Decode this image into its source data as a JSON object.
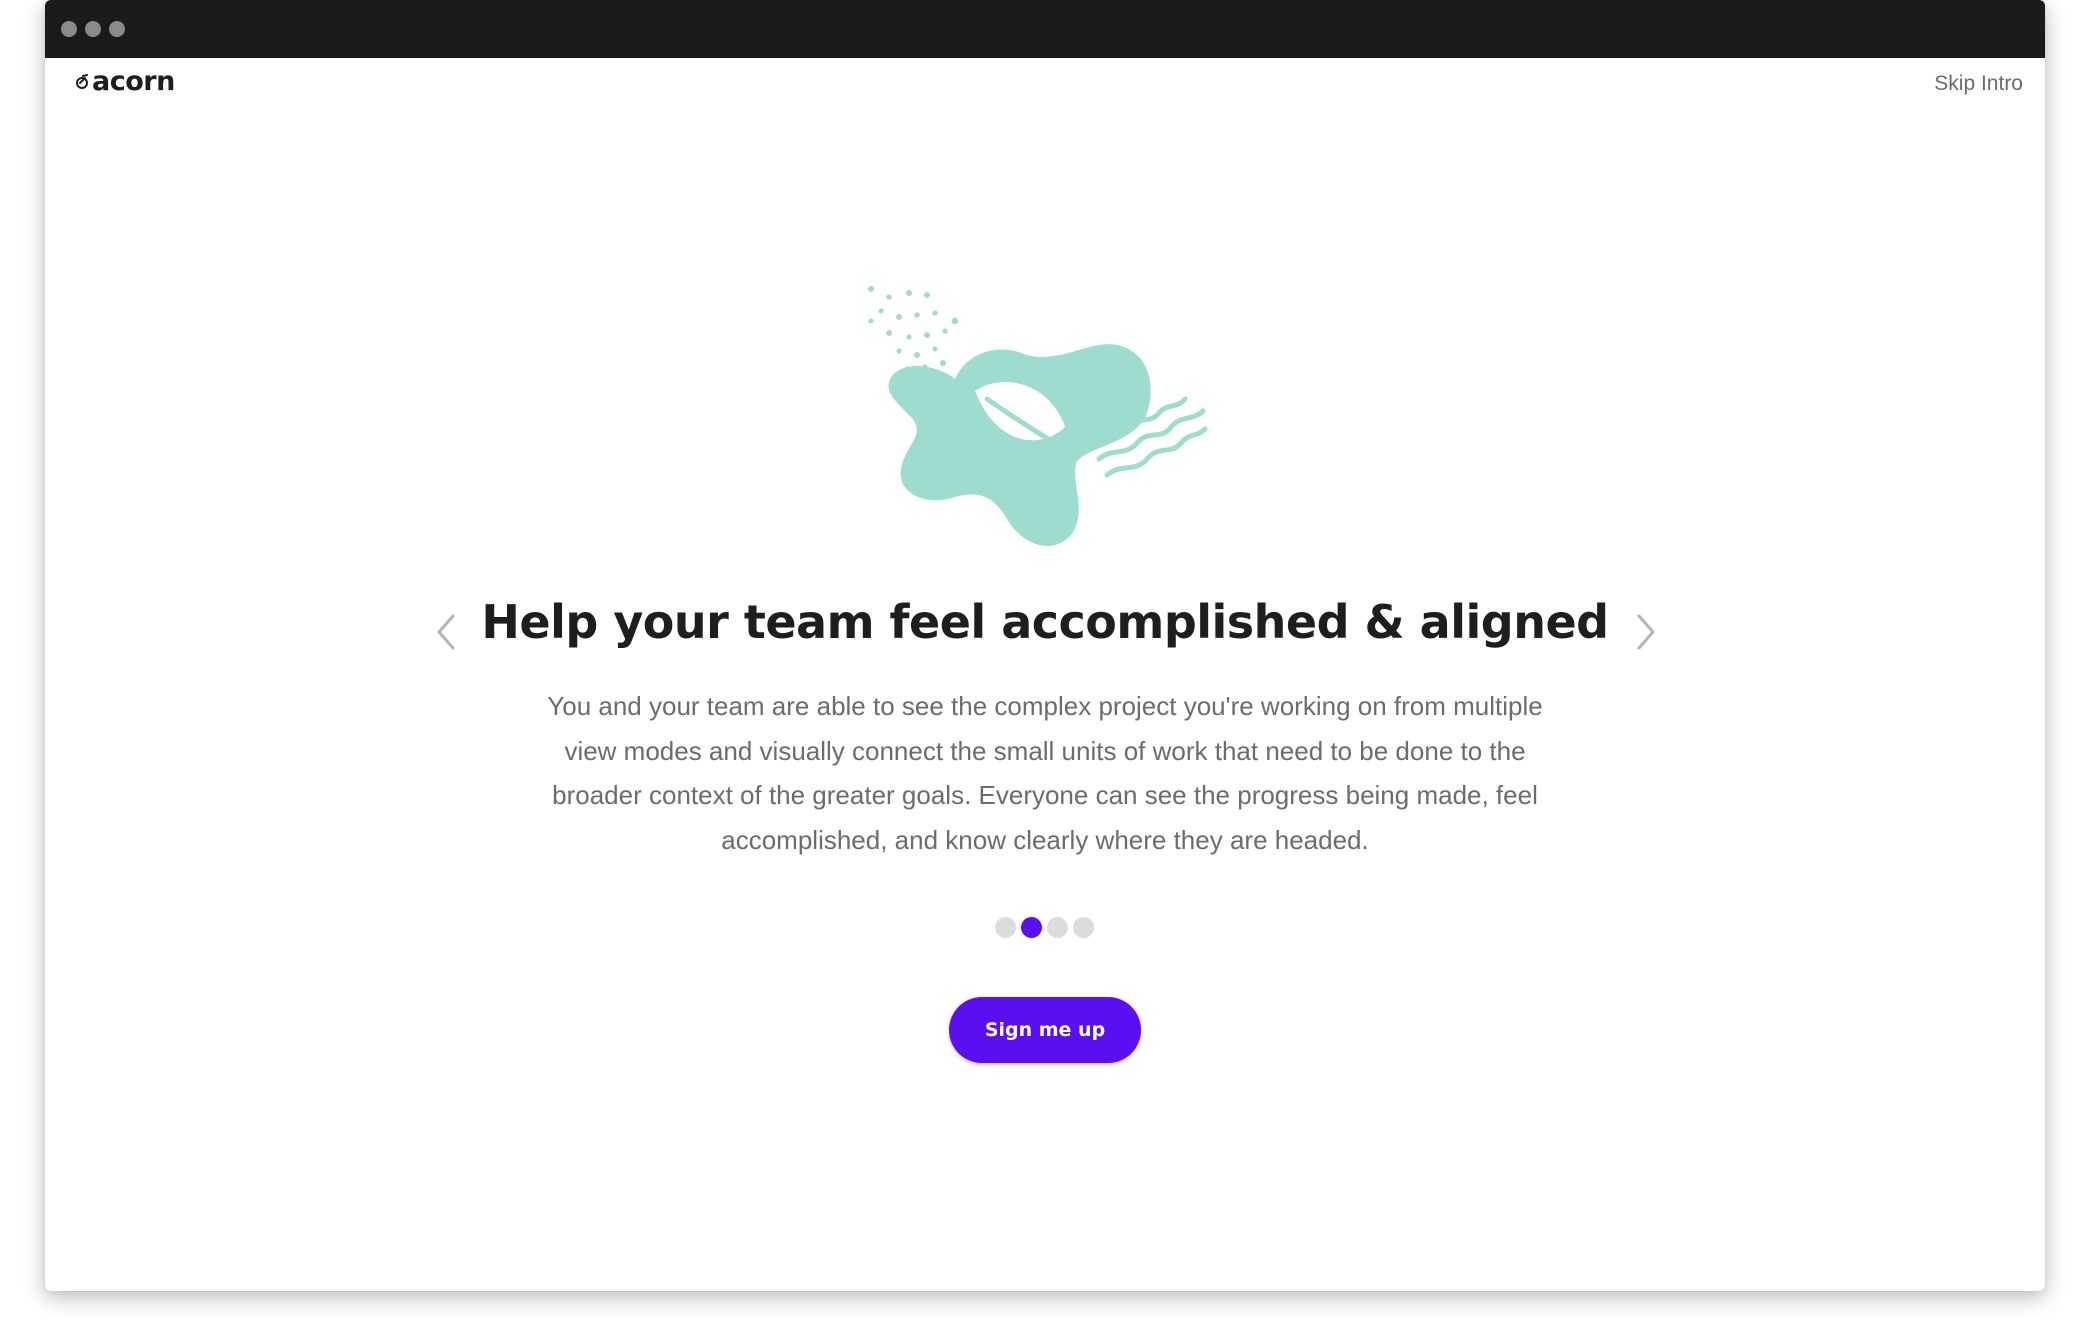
{
  "brand": {
    "name": "acorn",
    "accent_color": "#5b0ef0",
    "illustration_color": "#9edccf"
  },
  "header": {
    "skip_label": "Skip Intro"
  },
  "slide": {
    "title": "Help your team feel accomplished & aligned",
    "description": "You and your team are able to see the complex project you're working on from multiple view modes and visually connect the small units of work that need to be done to the broader context of the greater goals. Everyone can see the progress being made, feel accomplished, and know clearly where they are headed.",
    "illustration_icon": "leaf-blob-illustration"
  },
  "pagination": {
    "total": 4,
    "current": 2
  },
  "cta": {
    "label": "Sign me up"
  },
  "navigation": {
    "prev_icon": "chevron-left-icon",
    "next_icon": "chevron-right-icon"
  }
}
